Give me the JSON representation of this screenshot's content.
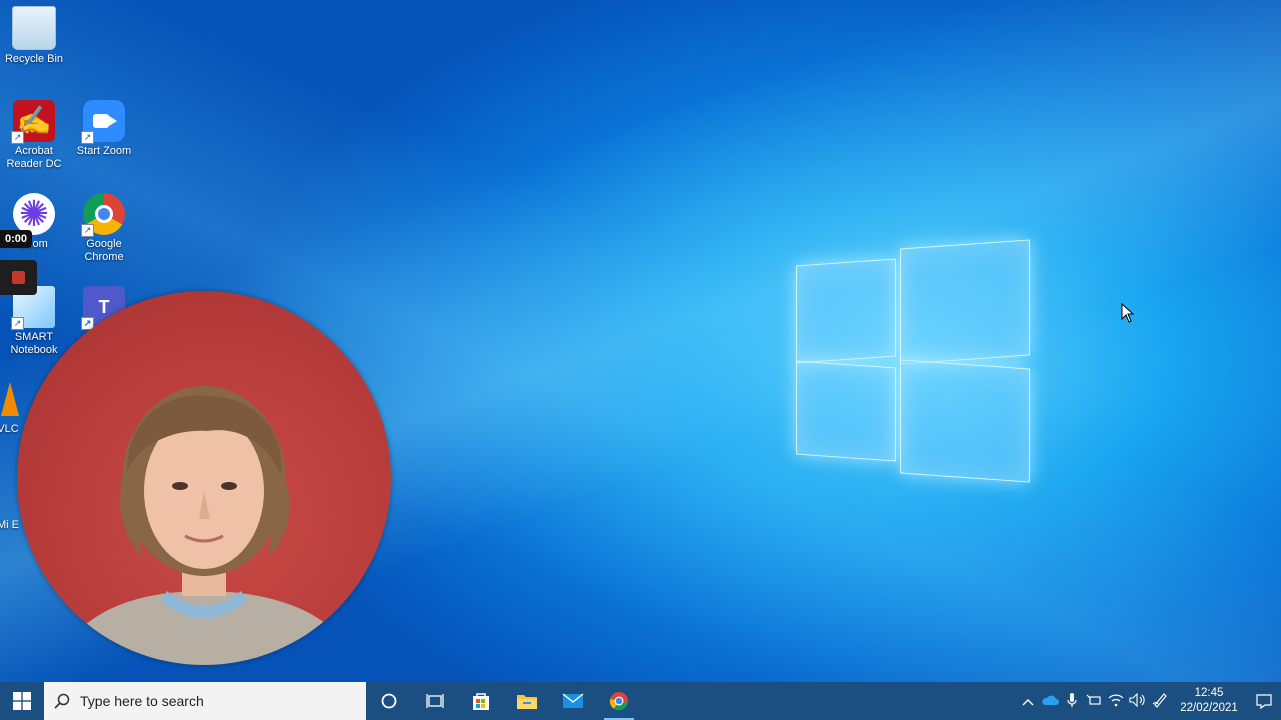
{
  "desktop": {
    "icons": [
      {
        "label": "Recycle Bin",
        "icon": "recycle-bin-icon"
      },
      {
        "label": "Acrobat Reader DC",
        "icon": "acrobat-icon"
      },
      {
        "label": "Start Zoom",
        "icon": "zoom-icon"
      },
      {
        "label": "Loom",
        "icon": "loom-icon"
      },
      {
        "label": "Google Chrome",
        "icon": "chrome-icon"
      },
      {
        "label": "SMART Notebook",
        "icon": "smart-notebook-icon"
      },
      {
        "label": "",
        "icon": "teams-icon"
      },
      {
        "label": "VLC",
        "icon": "vlc-icon"
      },
      {
        "label": "Mi E",
        "icon": "edge-icon"
      }
    ]
  },
  "recorder": {
    "timer": "0:00",
    "stop": "stop-record-icon"
  },
  "taskbar": {
    "search_placeholder": "Type here to search",
    "apps": [
      "cortana-icon",
      "task-view-icon",
      "store-icon",
      "file-explorer-icon",
      "mail-icon",
      "chrome-icon"
    ],
    "clock": {
      "time": "12:45",
      "date": "22/02/2021"
    }
  }
}
